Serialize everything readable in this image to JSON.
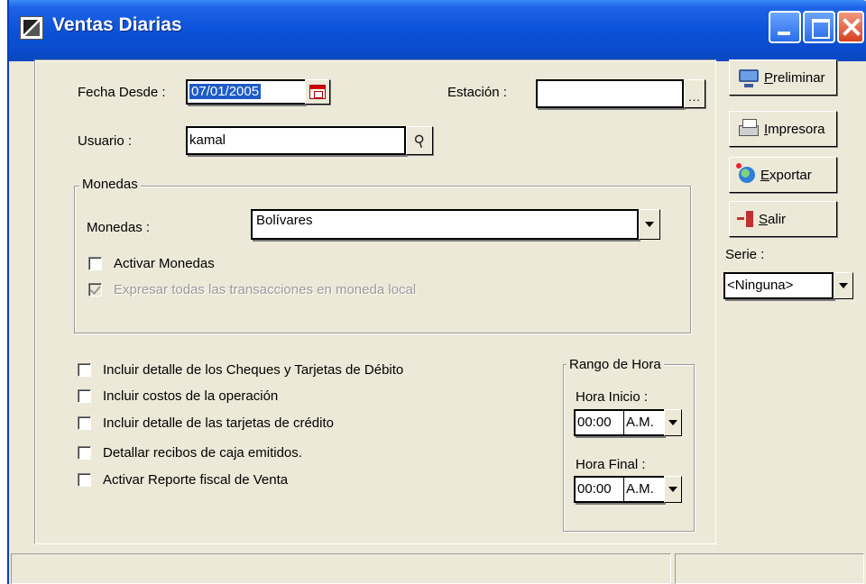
{
  "window": {
    "title": "Ventas Diarias"
  },
  "form": {
    "fecha_desde_label": "Fecha Desde :",
    "fecha_desde_value": "07/01/2005",
    "estacion_label": "Estación :",
    "estacion_value": "",
    "estacion_browse": "...",
    "usuario_label": "Usuario :",
    "usuario_value": "kamal"
  },
  "monedas_group": {
    "title": "Monedas",
    "monedas_label": "Monedas :",
    "monedas_value": "Bolívares",
    "activar_monedas": {
      "label": "Activar Monedas",
      "checked": false
    },
    "expresar_local": {
      "label": "Expresar todas las transacciones en moneda local",
      "checked": true,
      "disabled": true
    }
  },
  "options": [
    {
      "label": "Incluir detalle de los Cheques y Tarjetas de Débito",
      "checked": false
    },
    {
      "label": "Incluir costos de la operación",
      "checked": false
    },
    {
      "label": "Incluir detalle de las tarjetas de crédito",
      "checked": false
    },
    {
      "label": "Detallar recibos de caja emitidos.",
      "checked": false
    },
    {
      "label": "Activar  Reporte fiscal de Venta",
      "checked": false
    }
  ],
  "rango_hora": {
    "title": "Rango de Hora",
    "hora_inicio_label": "Hora Inicio :",
    "hora_inicio_time": "00:00",
    "hora_inicio_ampm": "A.M.",
    "hora_final_label": "Hora Final :",
    "hora_final_time": "00:00",
    "hora_final_ampm": "A.M."
  },
  "side_buttons": {
    "preliminar": {
      "first": "P",
      "rest": "reliminar",
      "icon": "monitor-icon"
    },
    "impresora": {
      "first": "I",
      "rest": "mpresora",
      "icon": "printer-icon"
    },
    "exportar": {
      "first": "E",
      "rest": "xportar",
      "icon": "globe-icon"
    },
    "salir": {
      "first": "S",
      "rest": "alir",
      "icon": "exit-icon"
    }
  },
  "serie": {
    "label": "Serie :",
    "value": "<Ninguna>"
  }
}
